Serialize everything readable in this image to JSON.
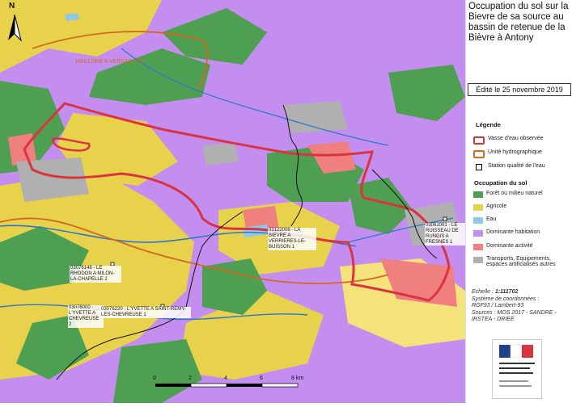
{
  "title": "Occupation du sol sur la Bievre de sa source au bassin de retenue de la Bièvre à Antony",
  "edit_date": "Édité le 25 novembre 2019",
  "north": "N",
  "place_label": "MAULDRE A VERSAILLES",
  "stations": [
    {
      "label": "03122008 - LA BIEVRE A VERRIERES-LE-BUISSON 1"
    },
    {
      "label": "03061001 - LE RUISSEAU DE RUNGIS A FRESNES 1"
    },
    {
      "label": "03076148 - LE RHODON A MILON-LA-CHAPELLE 2"
    },
    {
      "label": "03076000 - L'YVETTE A CHEVREUSE 2"
    },
    {
      "label": "03076220 - L'YVETTE A SAINT-REMY-LES-CHEVREUSE 1"
    }
  ],
  "legend": {
    "title": "Légende",
    "items": [
      {
        "label": "Vasse d'eau observée",
        "color": "#d9343f"
      },
      {
        "label": "Unité hydrographique",
        "color": "#d2691e"
      },
      {
        "label": "Station qualité de l'eau",
        "color": "#ffffff"
      }
    ],
    "land_title": "Occupation du sol",
    "land_items": [
      {
        "label": "Forêt ou milieu naturel",
        "color": "#4f9f52"
      },
      {
        "label": "Agricole",
        "color": "#e9d24b"
      },
      {
        "label": "Eau",
        "color": "#8ec9e8"
      },
      {
        "label": "Dominante habitation",
        "color": "#c38ef0"
      },
      {
        "label": "Dominante activité",
        "color": "#f07f7f"
      },
      {
        "label": "Transports, Equipements, espaces artificialisés autres",
        "color": "#b0b0b0"
      }
    ]
  },
  "meta": {
    "scale_label": "Echelle :",
    "scale_value": "1:111702",
    "crs_label": "Système de coordonnées :",
    "crs_value": "RGF93 / Lambert-93",
    "sources": "Sources : MOS 2017 - SANDRE - IRSTEA - DRIEE"
  },
  "scale_bar": [
    "0",
    "2",
    "4",
    "6",
    "8 km"
  ]
}
